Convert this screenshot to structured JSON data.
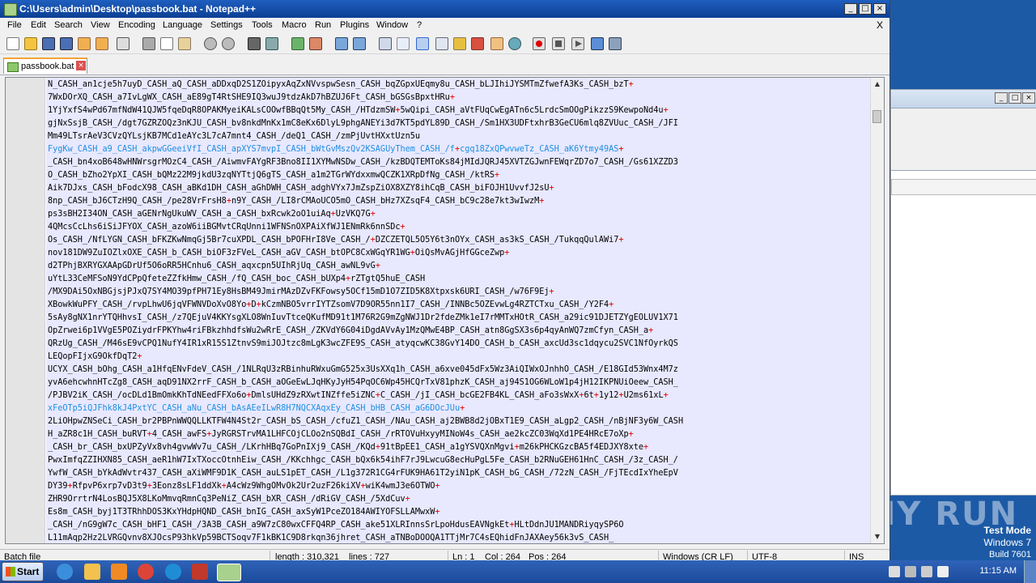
{
  "window": {
    "title": "C:\\Users\\admin\\Desktop\\passbook.bat - Notepad++"
  },
  "menu": [
    "File",
    "Edit",
    "Search",
    "View",
    "Encoding",
    "Language",
    "Settings",
    "Tools",
    "Macro",
    "Run",
    "Plugins",
    "Window",
    "?"
  ],
  "menu_close": "X",
  "tab": {
    "label": "passbook.bat"
  },
  "editor_lines": [
    "N_CASH_an1cje5h7uyD_CASH_aQ_CASH_aDDxqD2S1ZOipyxAqZxNVvspwSesn_CASH_bqZGpxUEqmy8u_CASH_bLJIhiJYSMTmZfwefA3Ks_CASH_bzT+",
    "7WxDOrXQ_CASH_a7IvLgWX_CASH_aE89gT4RtSHE9IQ3wuJ9tdzAkD7hBZUJ6Ft_CASH_bGSGsBpxtHRu+",
    "1YjYxfS4wPd67mfNdW41QJW5fqeDqR8OPAKMyeiKALsCOOwfBBqQt5My_CASH_/HTdzmSW+5wQipi_CASH_aVtFUqCwEgATn6c5LrdcSmOOgPikzzS9KewpoNd4u+",
    "gjNxSsjB_CASH_/dgt7GZRZOQz3nKJU_CASH_bv8nkdMnKx1mC8eKx6DlyL9phgANEYi3d7KT5pdYL89D_CASH_/Sm1HX3UDFtxhrB3GeCU6mlq8ZVUuc_CASH_/JFI",
    "Mm49LTsrAeV3CVzQYLsjKB7MCd1eAYc3L7cA7mnt4_CASH_/deQ1_CASH_/zmPjUvtHXxtUzn5u",
    "FygKw_CASH_a9_CASH_akpwGGeeiVfI_CASH_apXYS7mvpI_CASH_bWtGvMszQv2KSAGUyThem_CASH_/f+cgq18ZxQPwvweTz_CASH_aK6Ytmy49AS+",
    "_CASH_bn4xoB648wHNWrsgrMOzC4_CASH_/AiwmvFAYgRF3Bno8II1XYMwNSDw_CASH_/kzBDQTEMToKs84jMIdJQRJ45XVTZGJwnFEWqrZD7o7_CASH_/Gs61XZZD3",
    "O_CASH_bZho2YpXI_CASH_bQMz22M9jkdU3zqNYTtjQ6gTS_CASH_a1m2TGrWYdxxmwQCZK1XRpDfNg_CASH_/ktRS+",
    "Aik7DJxs_CASH_bFodcX98_CASH_aBKd1DH_CASH_aGhDWH_CASH_adghVYx7JmZspZiOX8XZY8ihCqB_CASH_biFOJH1UvvfJ2sU+",
    "8np_CASH_bJ6CTzH9Q_CASH_/pe28VrFrsH8+n9Y_CASH_/LI8rCMAoUCO5mO_CASH_bHz7XZsqF4_CASH_bC9c28e7kt3wIwzM+",
    "ps3sBH2I34ON_CASH_aGENrNgUkuWV_CASH_a_CASH_bxRcwk2oO1uiAq+UzVKQ7G+",
    "4QMcsCcLhs6iSiJFYOX_CASH_azoW6iiBGMvtCRqUnni1WFNSnOXPAiXfWJ1ENmRk6nnSDc+",
    "Os_CASH_/NfLYGN_CASH_bFKZKwNmqGj5Br7cuXPDL_CASH_bPOFHrI8Ve_CASH_/+DZCZETQL5O5Y6t3nOYx_CASH_as3kS_CASH_/TukqqQulAWi7+",
    "nov181DW9ZuIOZlxOXE_CASH_b_CASH_biOF3zFVeL_CASH_aGV_CASH_btOPC8CxWGqYR1WG+OiQsMvAGjHfGGceZwp+",
    "d2TPhjBXRYGXAApGDrUf5O6oRR5HCnhu6_CASH_aqxcpn5UIhRjUq_CASH_awNL9vG+",
    "uYtL33CeMFSoN9YdCPpQfeteZZfkHmw_CASH_/fQ_CASH_boc_CASH_bUXp4+rZTgtQ5huE_CASH",
    "/MX9DAi5OxNBGjsjPJxQ7SY4MO39pfPH71Ey8HsBM49JmirMAzDZvFKFowsy5OCf15mD1O7ZID5K8Xtpxsk6URI_CASH_/w76F9Ej+",
    "XBowkWuPFY_CASH_/rvpLhwU6jqVFWNVDoXvO8Yo+D+kCzmNBO5vrrIYTZsomV7D9OR55nn1I7_CASH_/INNBc5OZEvwLg4RZTCTxu_CASH_/Y2F4+",
    "5sAy8gNX1nrYTQHhvsI_CASH_/z7QEjuV4KKYsgXLO8WnIuvTtceQKufMD91t1M76R2G9mZgNWJ1Dr2fdeZMk1eI7rMMTxHOtR_CASH_a29ic91DJETZYgEOLUV1X71",
    "OpZrwei6p1VVgE5POZiydrFPKYhw4riFBkzhhdfsWu2wRrE_CASH_/ZKVdY6G04iDgdAVvAy1MzQMwE4BP_CASH_atn8GgSX3s6p4qyAnWQ7zmCfyn_CASH_a+",
    "QRzUg_CASH_/M46sE9vCPQ1NufY4IR1xR15S1ZtnvS9miJOJtzc8mLgK3wcZFE9S_CASH_atyqcwKC38GvY14DO_CASH_b_CASH_axcUd3sc1dqycu2SVC1NfOyrkQS",
    "LEQopFIjxG9OkfDqT2+",
    "UCYX_CASH_bOhg_CASH_a1HfqENvFdeV_CASH_/1NLRqU3zRBinhuRWxuGmG525x3UsXXq1h_CASH_a6xve045dFx5Wz3AiQIWxOJnhhO_CASH_/E18GId53Wnx4M7z",
    "yvA6ehcwhnHTcZg8_CASH_aqD91NX2rrF_CASH_b_CASH_aOGeEwLJqHKyJyH54PqOC6Wp45HCQrTxV81phzK_CASH_aj94S1OG6WLoW1p4jH12IKPNUiOeew_CASH_",
    "/PJBV2iK_CASH_/ocDLd1BmOmkKhTdNEedFFXo6o+DmlsUHdZ9zRXwtINZffe5iZNC+C_CASH_/jI_CASH_bcGE2FB4KL_CASH_aFo3sWxX+6t+1y12+U2ms61xL+",
    "xFeOTp5iQJFhk8kJ4PxtYC_CASH_aNu_CASH_bAsAEeILwR8H7NQCXAqxEy_CASH_bHB_CASH_aG6DOcJUu+",
    "2LiOHpwZNSeCi_CASH_br2PBPnWWQQLLKTFW4N4St2r_CASH_bS_CASH_/cfuZ1_CASH_/NAu_CASH_aj2BWB8d2jOBxT1E9_CASH_aLgp2_CASH_/nBjNF3y6W_CASH",
    "H_aZR8c1H_CASH_buRVT+4_CASH_awFS+JyRGRSTrvMA1LHFCOjCLOo2nSQBdI_CASH_/rRTOVuHxyyMINoW4s_CASH_ae2kcZC03WqXd1PE4HRcE7oXp+",
    "_CASH_br_CASH_bxUPZyVx8vh4gvwWv7u_CASH_/LKrhHBq7GoPnIXj9_CASH_/KQd+91tBpEE1_CASH_a1gYSVQXnMgvi+m26kPHCKGzcBA5f4EDJXY8xte+",
    "PwxImfqZZIHXN85_CASH_aeR1hW7IxTXoccOtnhEiw_CASH_/KKchhgc_CASH_bQx6k54ihF7rJ9LwcuG8ecHuPgL5Fe_CASH_b2RNuGEH61HnC_CASH_/3z_CASH_/",
    "YwfW_CASH_bYkAdWvtr437_CASH_aXiWMF9D1K_CASH_auLS1pET_CASH_/L1g372R1CG4rFUK9HA61T2yiN1pK_CASH_bG_CASH_/72zN_CASH_/FjTEcdIxYheEpV",
    "DY39+RfpvP6xrp7vD3t9+3Eonz8sLF1ddXk+A4cWz9WhgOMvOk2Ur2uzF26kiXV+wiK4wmJ3e6OTWO+",
    "ZHR9OrrtrN4LosBQJ5X8LKoMmvqRmnCq3PeNiZ_CASH_bXR_CASH_/dRiGV_CASH_/5XdCuv+",
    "Es8m_CASH_byj1T3TRhhDOS3KxYHdpHQND_CASH_bnIG_CASH_axSyW1PceZO184AWIYOFSLLAMwxW+",
    "_CASH_/nG9gW7c_CASH_bHF1_CASH_/3A3B_CASH_a9W7zC80wxCFFQ4RP_CASH_ake51XLRInnsSrLpoHdusEAVNgkEt+HLtDdnJU1MANDRiyqySP6O",
    "L11mAqp2Hz2LVRGQvnv8XJOcsP93hkVp59BCTSoqv7F1kBK1C9D8rkqn36jhret_CASH_aTNBoDOOQA1TTjMr7C4sEQhidFnJAXAey56k3vS_CASH_"
  ],
  "highlighted_line_indices": [
    5,
    25,
    36
  ],
  "status": {
    "file_type": "Batch file",
    "length": "length : 310,321",
    "lines": "lines : 727",
    "ln": "Ln : 1",
    "col": "Col : 264",
    "pos": "Pos : 264",
    "eol": "Windows (CR LF)",
    "encoding": "UTF-8",
    "mode": "INS"
  },
  "watermark": "ANY RUN",
  "testmode": {
    "line1": "Test Mode",
    "line2": "Windows 7",
    "line3": "Build 7601"
  },
  "taskbar": {
    "start_label": "Start",
    "clock": "11:15 AM"
  },
  "colors": {
    "titlebar": "#0c3f94",
    "editor_bg": "#e8e8ff",
    "plus": "#e00000",
    "highlight": "#1e8fe0",
    "tab_accent": "#f3a33a"
  }
}
